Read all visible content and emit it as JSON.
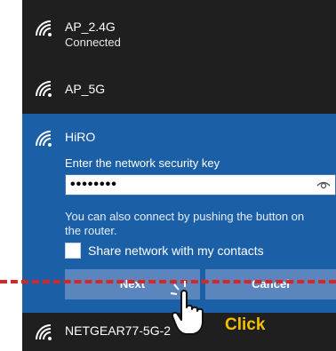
{
  "networks": [
    {
      "ssid": "AP_2.4G",
      "status": "Connected"
    },
    {
      "ssid": "AP_5G"
    },
    {
      "ssid": "NETGEAR77-5G-2"
    }
  ],
  "selected_network": {
    "ssid": "HiRO",
    "key_prompt": "Enter the network security key",
    "key_value": "••••••••",
    "info_line1": "You can also connect by pushing the button on",
    "info_line2": "the router.",
    "share_label": "Share network with my contacts",
    "share_checked": false,
    "next_label": "Next",
    "cancel_label": "Cancel"
  },
  "annotation": {
    "click_label": "Click",
    "click_color": "#f2c100",
    "line_color": "#d92525"
  },
  "colors": {
    "panel_bg": "#1f1f1f",
    "selected_bg": "#1b5fa6",
    "button_bg": "#5a86bd"
  },
  "icons": {
    "wifi": "wifi-signal-icon",
    "reveal": "eye-icon",
    "pointer": "hand-pointer-icon"
  }
}
